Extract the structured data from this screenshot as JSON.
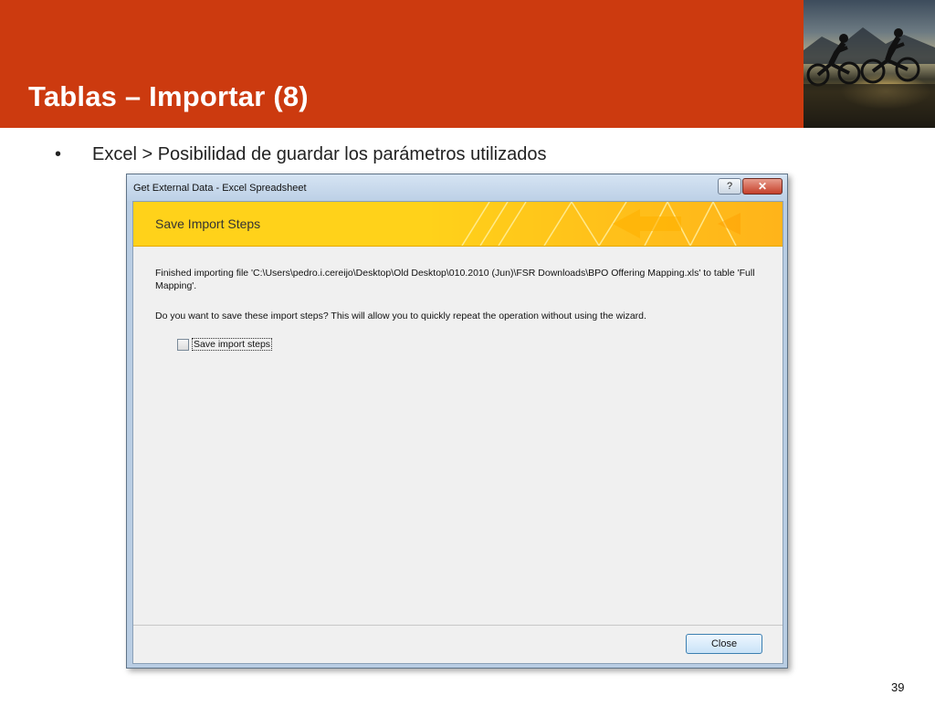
{
  "slide": {
    "title": "Tablas – Importar (8)",
    "bullet_marker": "•",
    "bullet_text": "Excel > Posibilidad de guardar los parámetros utilizados",
    "page_number": "39",
    "accent_color": "#cc3a0f"
  },
  "dialog": {
    "window_title": "Get External Data - Excel Spreadsheet",
    "help_label": "?",
    "close_glyph": "✕",
    "banner_title": "Save Import Steps",
    "message_finished": "Finished importing file 'C:\\Users\\pedro.i.cereijo\\Desktop\\Old Desktop\\010.2010 (Jun)\\FSR Downloads\\BPO Offering Mapping.xls' to table 'Full Mapping'.",
    "message_question": "Do you want to save these import steps? This will allow you to quickly repeat the operation without using the wizard.",
    "checkbox_label": "Save import steps",
    "checkbox_checked": false,
    "close_button_label": "Close",
    "banner_color": "#ffd21a"
  }
}
